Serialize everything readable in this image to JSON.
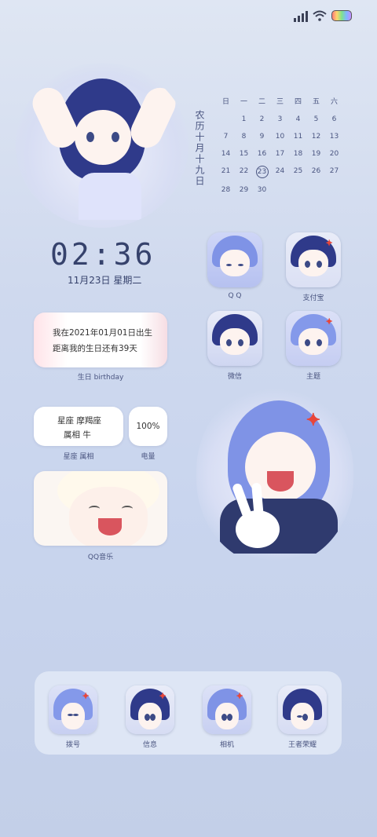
{
  "calendar": {
    "lunar_date": "农历十月十九日",
    "weekdays": [
      "日",
      "一",
      "二",
      "三",
      "四",
      "五",
      "六"
    ],
    "weeks": [
      [
        "",
        "1",
        "2",
        "3",
        "4",
        "5",
        "6"
      ],
      [
        "7",
        "8",
        "9",
        "10",
        "11",
        "12",
        "13"
      ],
      [
        "14",
        "15",
        "16",
        "17",
        "18",
        "19",
        "20"
      ],
      [
        "21",
        "22",
        "23",
        "24",
        "25",
        "26",
        "27"
      ],
      [
        "28",
        "29",
        "30",
        "",
        "",
        "",
        ""
      ]
    ],
    "today": "23"
  },
  "clock": {
    "time": "02:36",
    "date": "11月23日 星期二"
  },
  "birthday_widget": {
    "line1": "我在2021年01月01日出生",
    "line2": "距离我的生日还有39天",
    "caption": "生日 birthday"
  },
  "zodiac_widget": {
    "constellation": "星座 摩羯座",
    "chinese_zodiac": "属相 牛",
    "caption": "星座 属相"
  },
  "battery_widget": {
    "value": "100%",
    "caption": "电量"
  },
  "music_widget": {
    "caption": "QQ音乐"
  },
  "apps": [
    {
      "label": "Q Q",
      "icon": "qq-icon"
    },
    {
      "label": "支付宝",
      "icon": "alipay-icon"
    },
    {
      "label": "微信",
      "icon": "wechat-icon"
    },
    {
      "label": "主题",
      "icon": "theme-icon"
    }
  ],
  "dock": [
    {
      "label": "拨号",
      "icon": "phone-icon"
    },
    {
      "label": "信息",
      "icon": "messages-icon"
    },
    {
      "label": "相机",
      "icon": "camera-icon"
    },
    {
      "label": "王者荣耀",
      "icon": "game-icon"
    }
  ],
  "colors": {
    "hair_dark": "#2f3a8a",
    "hair_light": "#7f93e6",
    "accent": "#e8463a",
    "text": "#3a4770"
  }
}
